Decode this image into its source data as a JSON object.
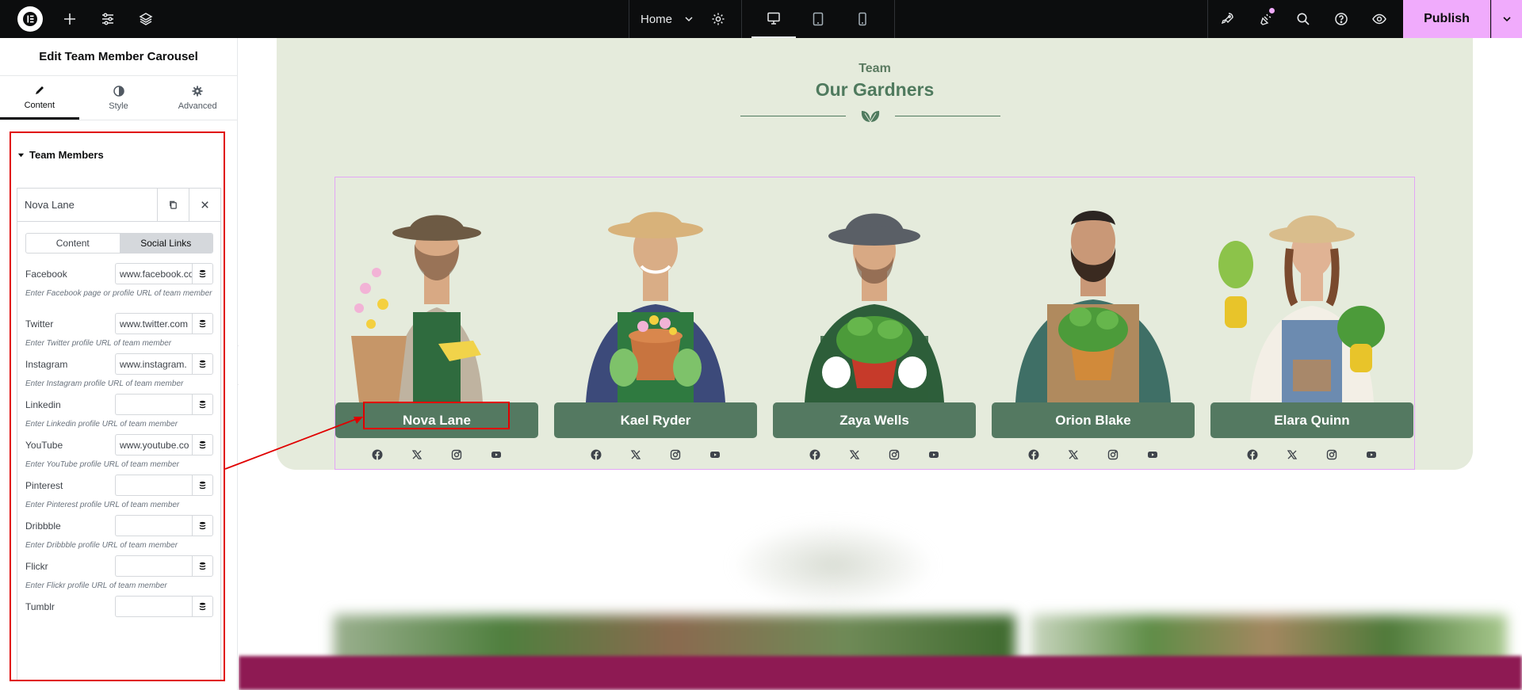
{
  "topbar": {
    "page_name": "Home",
    "publish_label": "Publish",
    "icons": [
      "elementor-logo-icon",
      "add-icon",
      "sliders-icon",
      "layers-icon",
      "chevron-down-icon",
      "gear-icon",
      "desktop-icon",
      "tablet-icon",
      "mobile-icon",
      "rocket-icon",
      "notifications-icon",
      "search-icon",
      "help-icon",
      "preview-eye-icon"
    ]
  },
  "panel": {
    "title": "Edit Team Member Carousel",
    "tabs": [
      {
        "label": "Content",
        "icon": "pencil-icon",
        "active": true
      },
      {
        "label": "Style",
        "icon": "contrast-icon",
        "active": false
      },
      {
        "label": "Advanced",
        "icon": "gear-icon",
        "active": false
      }
    ],
    "section_title": "Team Members",
    "repeater_item": "Nova Lane",
    "inner_tabs": [
      "Content",
      "Social Links"
    ],
    "fields": [
      {
        "label": "Facebook",
        "value": "www.facebook.com",
        "help": "Enter Facebook page or profile URL of team member"
      },
      {
        "label": "Twitter",
        "value": "www.twitter.com",
        "help": "Enter Twitter profile URL of team member"
      },
      {
        "label": "Instagram",
        "value": "www.instagram.",
        "help": "Enter Instagram profile URL of team member"
      },
      {
        "label": "Linkedin",
        "value": "",
        "help": "Enter Linkedin profile URL of team member"
      },
      {
        "label": "YouTube",
        "value": "www.youtube.co",
        "help": "Enter YouTube profile URL of team member"
      },
      {
        "label": "Pinterest",
        "value": "",
        "help": "Enter Pinterest profile URL of team member"
      },
      {
        "label": "Dribbble",
        "value": "",
        "help": "Enter Dribbble profile URL of team member"
      },
      {
        "label": "Flickr",
        "value": "",
        "help": "Enter Flickr profile URL of team member"
      },
      {
        "label": "Tumblr",
        "value": "",
        "help": ""
      }
    ]
  },
  "canvas": {
    "kicker": "Team",
    "title": "Our Gardners",
    "members": [
      {
        "name": "Nova Lane",
        "hat": "#6d5a44",
        "shirt": "#bfb3a0",
        "apron": "#2f6b3e"
      },
      {
        "name": "Kael Ryder",
        "hat": "#d8b27a",
        "shirt": "#3c4a7a",
        "apron": "#2f7a40"
      },
      {
        "name": "Zaya Wells",
        "hat": "#5a5f66",
        "shirt": "#2d5e3a",
        "apron": "#2d5e3a"
      },
      {
        "name": "Orion Blake",
        "hat": "#2b2522",
        "shirt": "#3f6f66",
        "apron": "#b08a5e"
      },
      {
        "name": "Elara Quinn",
        "hat": "#d9bd8c",
        "shirt": "#f3efe6",
        "apron": "#6c8bb0"
      }
    ],
    "social_icons": [
      "facebook-icon",
      "x-twitter-icon",
      "instagram-icon",
      "youtube-icon"
    ]
  },
  "colors": {
    "accent": "#f0abfc",
    "brand_green": "#547961",
    "section_bg": "#e5ebdc",
    "highlight": "#e00000"
  }
}
